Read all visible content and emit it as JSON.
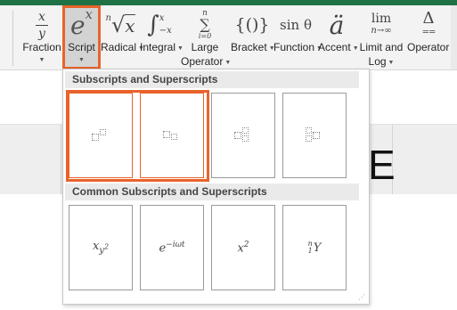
{
  "ribbon": {
    "buttons": [
      {
        "id": "fraction",
        "label": "Fraction",
        "icon": "fraction-icon",
        "caret": true
      },
      {
        "id": "script",
        "label": "Script",
        "icon": "script-icon",
        "caret": true,
        "selected": true
      },
      {
        "id": "radical",
        "label": "Radical",
        "icon": "radical-icon",
        "caret": true
      },
      {
        "id": "integral",
        "label": "Integral",
        "icon": "integral-icon",
        "caret": true
      },
      {
        "id": "large-operator",
        "label": "Large",
        "label2": "Operator",
        "icon": "large-operator-icon",
        "caret": true
      },
      {
        "id": "bracket",
        "label": "Bracket",
        "icon": "bracket-icon",
        "caret": true
      },
      {
        "id": "function",
        "label": "Function",
        "icon": "function-icon",
        "caret": true
      },
      {
        "id": "accent",
        "label": "Accent",
        "icon": "accent-icon",
        "caret": true
      },
      {
        "id": "limit-log",
        "label": "Limit and",
        "label2": "Log",
        "icon": "limit-icon",
        "caret": true
      },
      {
        "id": "operator",
        "label": "Operator",
        "icon": "operator-icon",
        "caret": true
      }
    ],
    "icons_text": {
      "fraction_num": "x",
      "fraction_den": "y",
      "script_base": "e",
      "script_sup": "x",
      "radical_index": "n",
      "radical_base": "x",
      "integral_upper": "x",
      "integral_lower": "−x",
      "sum_top": "n",
      "sum_bottom": "i=0",
      "bracket": "{()}",
      "function": "sin θ",
      "accent": "ä",
      "limit_top": "lim",
      "limit_bottom": "n→∞",
      "operator_top": "Δ",
      "operator_bottom": "=="
    },
    "accent_color": "#e8632b"
  },
  "document": {
    "cell_text": "E"
  },
  "gallery": {
    "section1_title": "Subscripts and Superscripts",
    "section2_title": "Common Subscripts and Superscripts",
    "common": {
      "t1_base": "x",
      "t1_sub": "y",
      "t1_subsup": "2",
      "t2_base": "e",
      "t2_sup": "−iωt",
      "t3_base": "x",
      "t3_sup": "2",
      "t4_pre_sup": "n",
      "t4_pre_sub": "1",
      "t4_base": "Y"
    }
  }
}
